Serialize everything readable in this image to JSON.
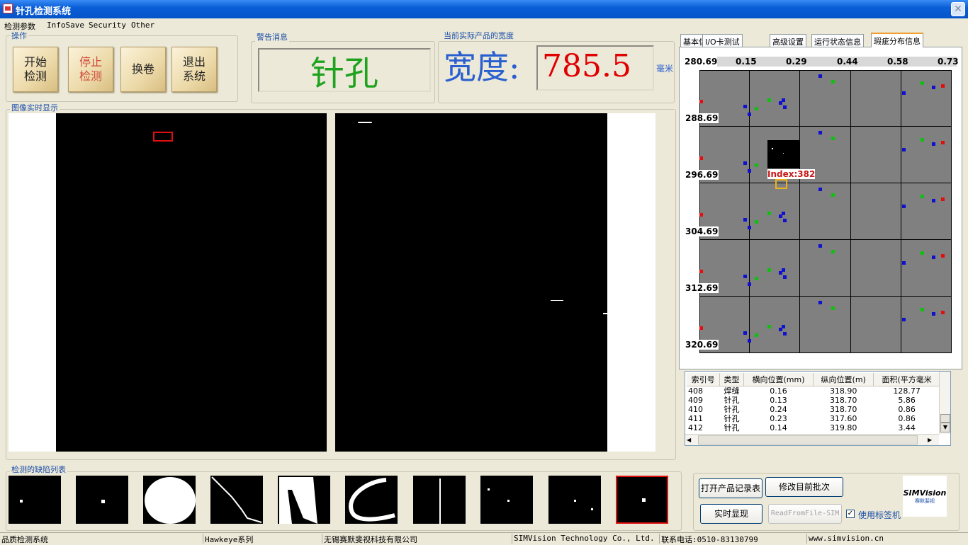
{
  "window": {
    "title": "针孔检测系统",
    "close_symbol": "✕"
  },
  "menu": [
    "检测参数",
    "InfoSave",
    "Security",
    "Other"
  ],
  "ops": {
    "group": "操作",
    "start": "开始\n检测",
    "stop": "停止\n检测",
    "change": "换卷",
    "exit": "退出\n系统"
  },
  "warn": {
    "group": "警告消息",
    "value": "针孔"
  },
  "width": {
    "group": "当前实际产品的宽度",
    "label": "宽度:",
    "value": "785.5",
    "unit": "毫米"
  },
  "image": {
    "group": "图像实时显示"
  },
  "tabs": [
    "基本信息",
    "I/O卡测试",
    "高级设置",
    "运行状态信息",
    "瑕疵分布信息"
  ],
  "map": {
    "x_labels": [
      "280.69",
      "0.15",
      "0.29",
      "0.44",
      "0.58",
      "0.73"
    ],
    "y_labels": [
      "288.69",
      "296.69",
      "304.69",
      "312.69",
      "320.69"
    ],
    "index_label": "Index:382"
  },
  "defect_table": {
    "headers": [
      "索引号",
      "类型",
      "横向位置(mm)",
      "纵向位置(m)",
      "面积(平方毫米"
    ],
    "rows": [
      [
        "408",
        "焊缝",
        "0.16",
        "318.90",
        "128.77"
      ],
      [
        "409",
        "针孔",
        "0.13",
        "318.70",
        "5.86"
      ],
      [
        "410",
        "针孔",
        "0.24",
        "318.70",
        "0.86"
      ],
      [
        "411",
        "针孔",
        "0.23",
        "317.60",
        "0.86"
      ],
      [
        "412",
        "针孔",
        "0.14",
        "319.80",
        "3.44"
      ]
    ]
  },
  "defect_list": {
    "group": "检测的缺陷列表"
  },
  "buttons": {
    "open_records": "打开产品记录表",
    "modify_batch": "修改目前批次",
    "realtime": "实时显现",
    "read_file": "ReadFromFile-SIM",
    "use_label": "使用标签机"
  },
  "logo": {
    "text": "SIMVision",
    "sub": "赛默斐视"
  },
  "status": [
    "品质检测系统",
    "Hawkeye系列",
    "无锡赛默斐视科技有限公司",
    "SIMVision Technology Co., Ltd.",
    "联系电话:0510-83130799",
    "www.simvision.cn"
  ],
  "colors": {
    "warn": "#1fa31f",
    "width_value": "#e00000",
    "label_blue": "#2a5fd0"
  }
}
